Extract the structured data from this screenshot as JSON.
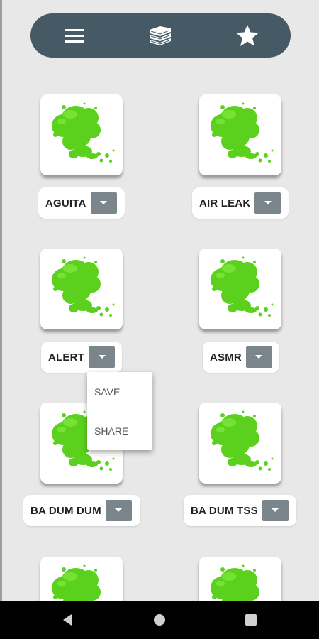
{
  "toolbar": {
    "icons": [
      "menu-icon",
      "books-icon",
      "star-icon"
    ]
  },
  "sounds": [
    {
      "label": "AGUITA"
    },
    {
      "label": "AIR LEAK"
    },
    {
      "label": "ALERT"
    },
    {
      "label": "ASMR"
    },
    {
      "label": "BA DUM DUM"
    },
    {
      "label": "BA DUM TSS"
    }
  ],
  "popup_menu": {
    "items": [
      "SAVE",
      "SHARE"
    ]
  },
  "nav_bar": {
    "icons": [
      "back-icon",
      "home-icon",
      "recents-icon"
    ]
  },
  "colors": {
    "toolbar": "#455a64",
    "splat": "#5bd11d",
    "dropdown": "#7a858c",
    "background": "#e8e8e8"
  }
}
